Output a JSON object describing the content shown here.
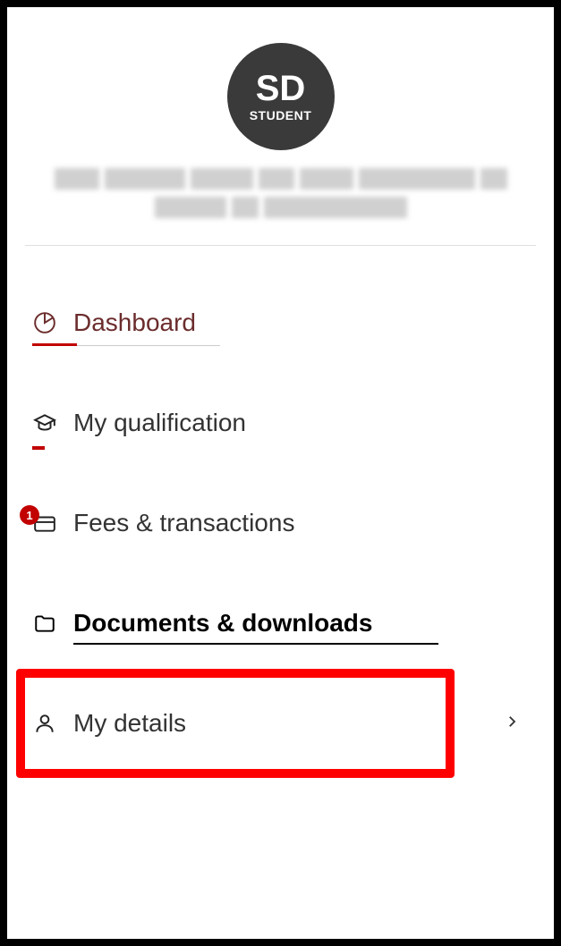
{
  "avatar": {
    "initials": "SD",
    "role": "STUDENT"
  },
  "nav": {
    "dashboard": {
      "label": "Dashboard"
    },
    "qualification": {
      "label": "My qualification"
    },
    "fees": {
      "label": "Fees & transactions",
      "badge": "1"
    },
    "documents": {
      "label": "Documents & downloads"
    },
    "details": {
      "label": "My details"
    }
  }
}
